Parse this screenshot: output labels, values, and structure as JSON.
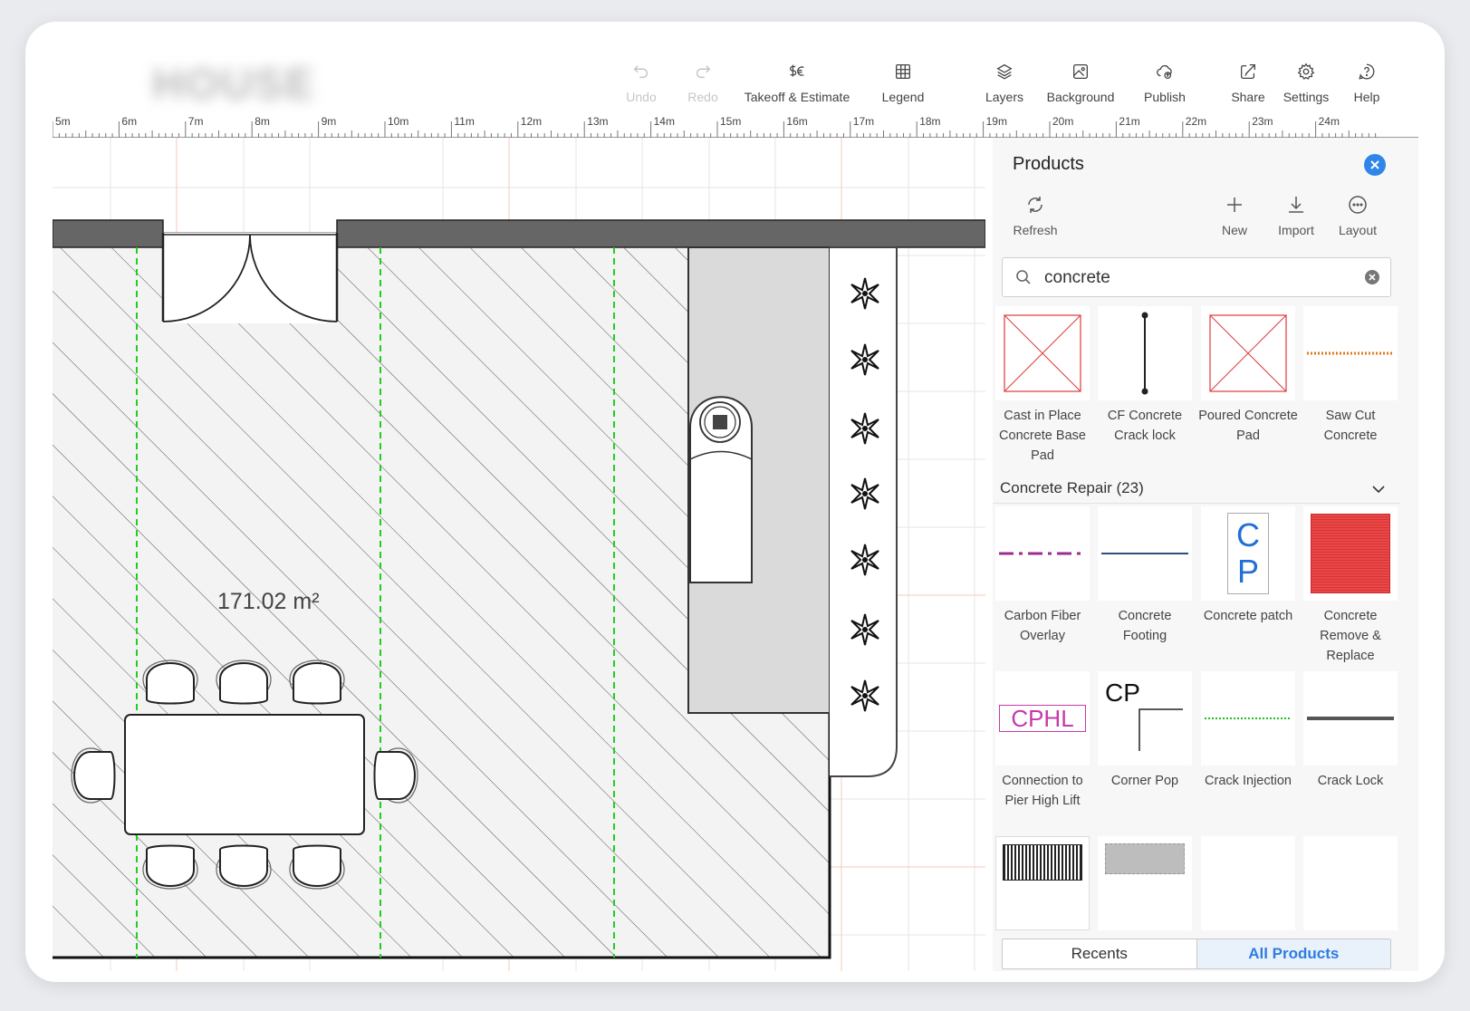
{
  "toolbar": {
    "undo": "Undo",
    "redo": "Redo",
    "takeoff": "Takeoff & Estimate",
    "legend": "Legend",
    "layers": "Layers",
    "background": "Background",
    "publish": "Publish",
    "share": "Share",
    "settings": "Settings",
    "help": "Help"
  },
  "ruler": {
    "labels": [
      "5m",
      "6m",
      "7m",
      "8m",
      "9m",
      "10m",
      "11m",
      "12m",
      "13m",
      "14m",
      "15m",
      "16m",
      "17m",
      "18m",
      "19m",
      "20m",
      "21m",
      "22m",
      "23m",
      "24m"
    ]
  },
  "canvas": {
    "area_label": "171.02 m²"
  },
  "panel": {
    "title": "Products",
    "actions": {
      "refresh": "Refresh",
      "new": "New",
      "import": "Import",
      "layout": "Layout"
    },
    "search": {
      "value": "concrete"
    },
    "results": [
      {
        "label": "Cast in Place Concrete Base Pad"
      },
      {
        "label": "CF Concrete Crack lock"
      },
      {
        "label": "Poured Concrete Pad"
      },
      {
        "label": "Saw Cut Concrete"
      }
    ],
    "group": {
      "title": "Concrete Repair (23)",
      "items": [
        {
          "label": "Carbon Fiber Overlay"
        },
        {
          "label": "Concrete Footing"
        },
        {
          "label": "Concrete patch",
          "symbol_top": "C",
          "symbol_bottom": "P"
        },
        {
          "label": "Concrete Remove & Replace"
        },
        {
          "label": "Connection to Pier High Lift",
          "symbol": "CPHL"
        },
        {
          "label": "Corner Pop",
          "symbol": "CP"
        },
        {
          "label": "Crack Injection"
        },
        {
          "label": "Crack Lock"
        }
      ]
    },
    "tabs": {
      "recents": "Recents",
      "all_products": "All Products"
    }
  },
  "colors": {
    "accent": "#2f86e8",
    "wall": "#666666",
    "guide": "#1fcf1f",
    "grid_major": "#f6c8b8",
    "thumb_red": "#e03a3a",
    "dot_orange": "#e07a1a",
    "dashdot_purple": "#9b2d8e",
    "cphl_magenta": "#c43ba8"
  }
}
